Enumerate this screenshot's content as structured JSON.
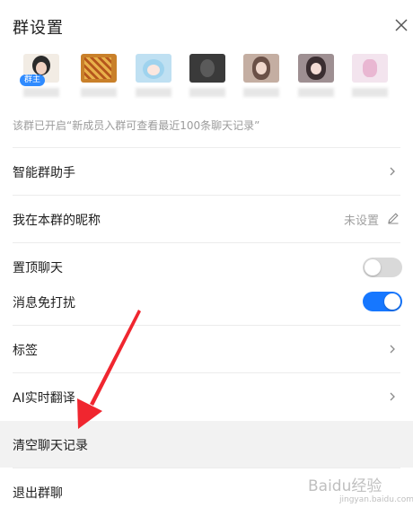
{
  "header": {
    "title": "群设置"
  },
  "members": {
    "owner_badge": "群主",
    "items": [
      {
        "avatar_color": "#f2ece4"
      },
      {
        "avatar_color": "#c9802a"
      },
      {
        "avatar_color": "#bfe0f2"
      },
      {
        "avatar_color": "#3a3a3a"
      },
      {
        "avatar_color": "#c4aea2"
      },
      {
        "avatar_color": "#9e8f92"
      },
      {
        "avatar_color": "#f3e4ee"
      }
    ]
  },
  "notice": "该群已开启“新成员入群可查看最近100条聊天记录”",
  "settings": {
    "assistant": "智能群助手",
    "nickname": "我在本群的昵称",
    "nickname_value": "未设置",
    "pin_chat": "置顶聊天",
    "pin_chat_on": false,
    "mute": "消息免打扰",
    "mute_on": true,
    "tags": "标签",
    "ai_translate": "AI实时翻译",
    "clear_history": "清空聊天记录",
    "leave_group": "退出群聊"
  },
  "colors": {
    "toggle_on": "#1677ff",
    "toggle_off": "#d9d9d9",
    "annotation_arrow": "#f0262f"
  },
  "watermark": {
    "text": "Baidu经验",
    "sub": "jingyan.baidu.com"
  }
}
